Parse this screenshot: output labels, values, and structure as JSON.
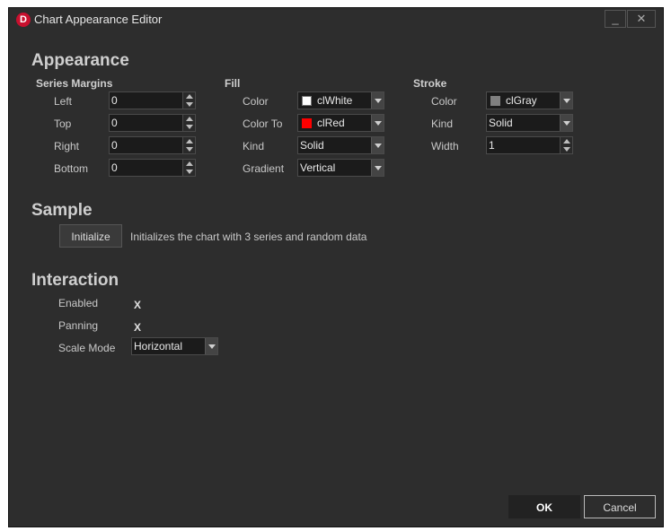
{
  "window": {
    "title": "Chart Appearance Editor",
    "logo_letter": "D",
    "minimize": "_",
    "close": "✕"
  },
  "appearance": {
    "title": "Appearance",
    "margins": {
      "title": "Series Margins",
      "left": {
        "label": "Left",
        "value": "0"
      },
      "top": {
        "label": "Top",
        "value": "0"
      },
      "right": {
        "label": "Right",
        "value": "0"
      },
      "bottom": {
        "label": "Bottom",
        "value": "0"
      }
    },
    "fill": {
      "title": "Fill",
      "color": {
        "label": "Color",
        "value": "clWhite",
        "swatch": "#ffffff"
      },
      "color_to": {
        "label": "Color To",
        "value": "clRed",
        "swatch": "#ff0000"
      },
      "kind": {
        "label": "Kind",
        "value": "Solid"
      },
      "gradient": {
        "label": "Gradient",
        "value": "Vertical"
      }
    },
    "stroke": {
      "title": "Stroke",
      "color": {
        "label": "Color",
        "value": "clGray",
        "swatch": "#808080"
      },
      "kind": {
        "label": "Kind",
        "value": "Solid"
      },
      "width": {
        "label": "Width",
        "value": "1"
      }
    }
  },
  "sample": {
    "title": "Sample",
    "initialize_label": "Initialize",
    "description": "Initializes the chart with 3 series and random data"
  },
  "interaction": {
    "title": "Interaction",
    "enabled": {
      "label": "Enabled",
      "mark": "X"
    },
    "panning": {
      "label": "Panning",
      "mark": "X"
    },
    "scale_mode": {
      "label": "Scale Mode",
      "value": "Horizontal"
    }
  },
  "footer": {
    "ok": "OK",
    "cancel": "Cancel"
  }
}
